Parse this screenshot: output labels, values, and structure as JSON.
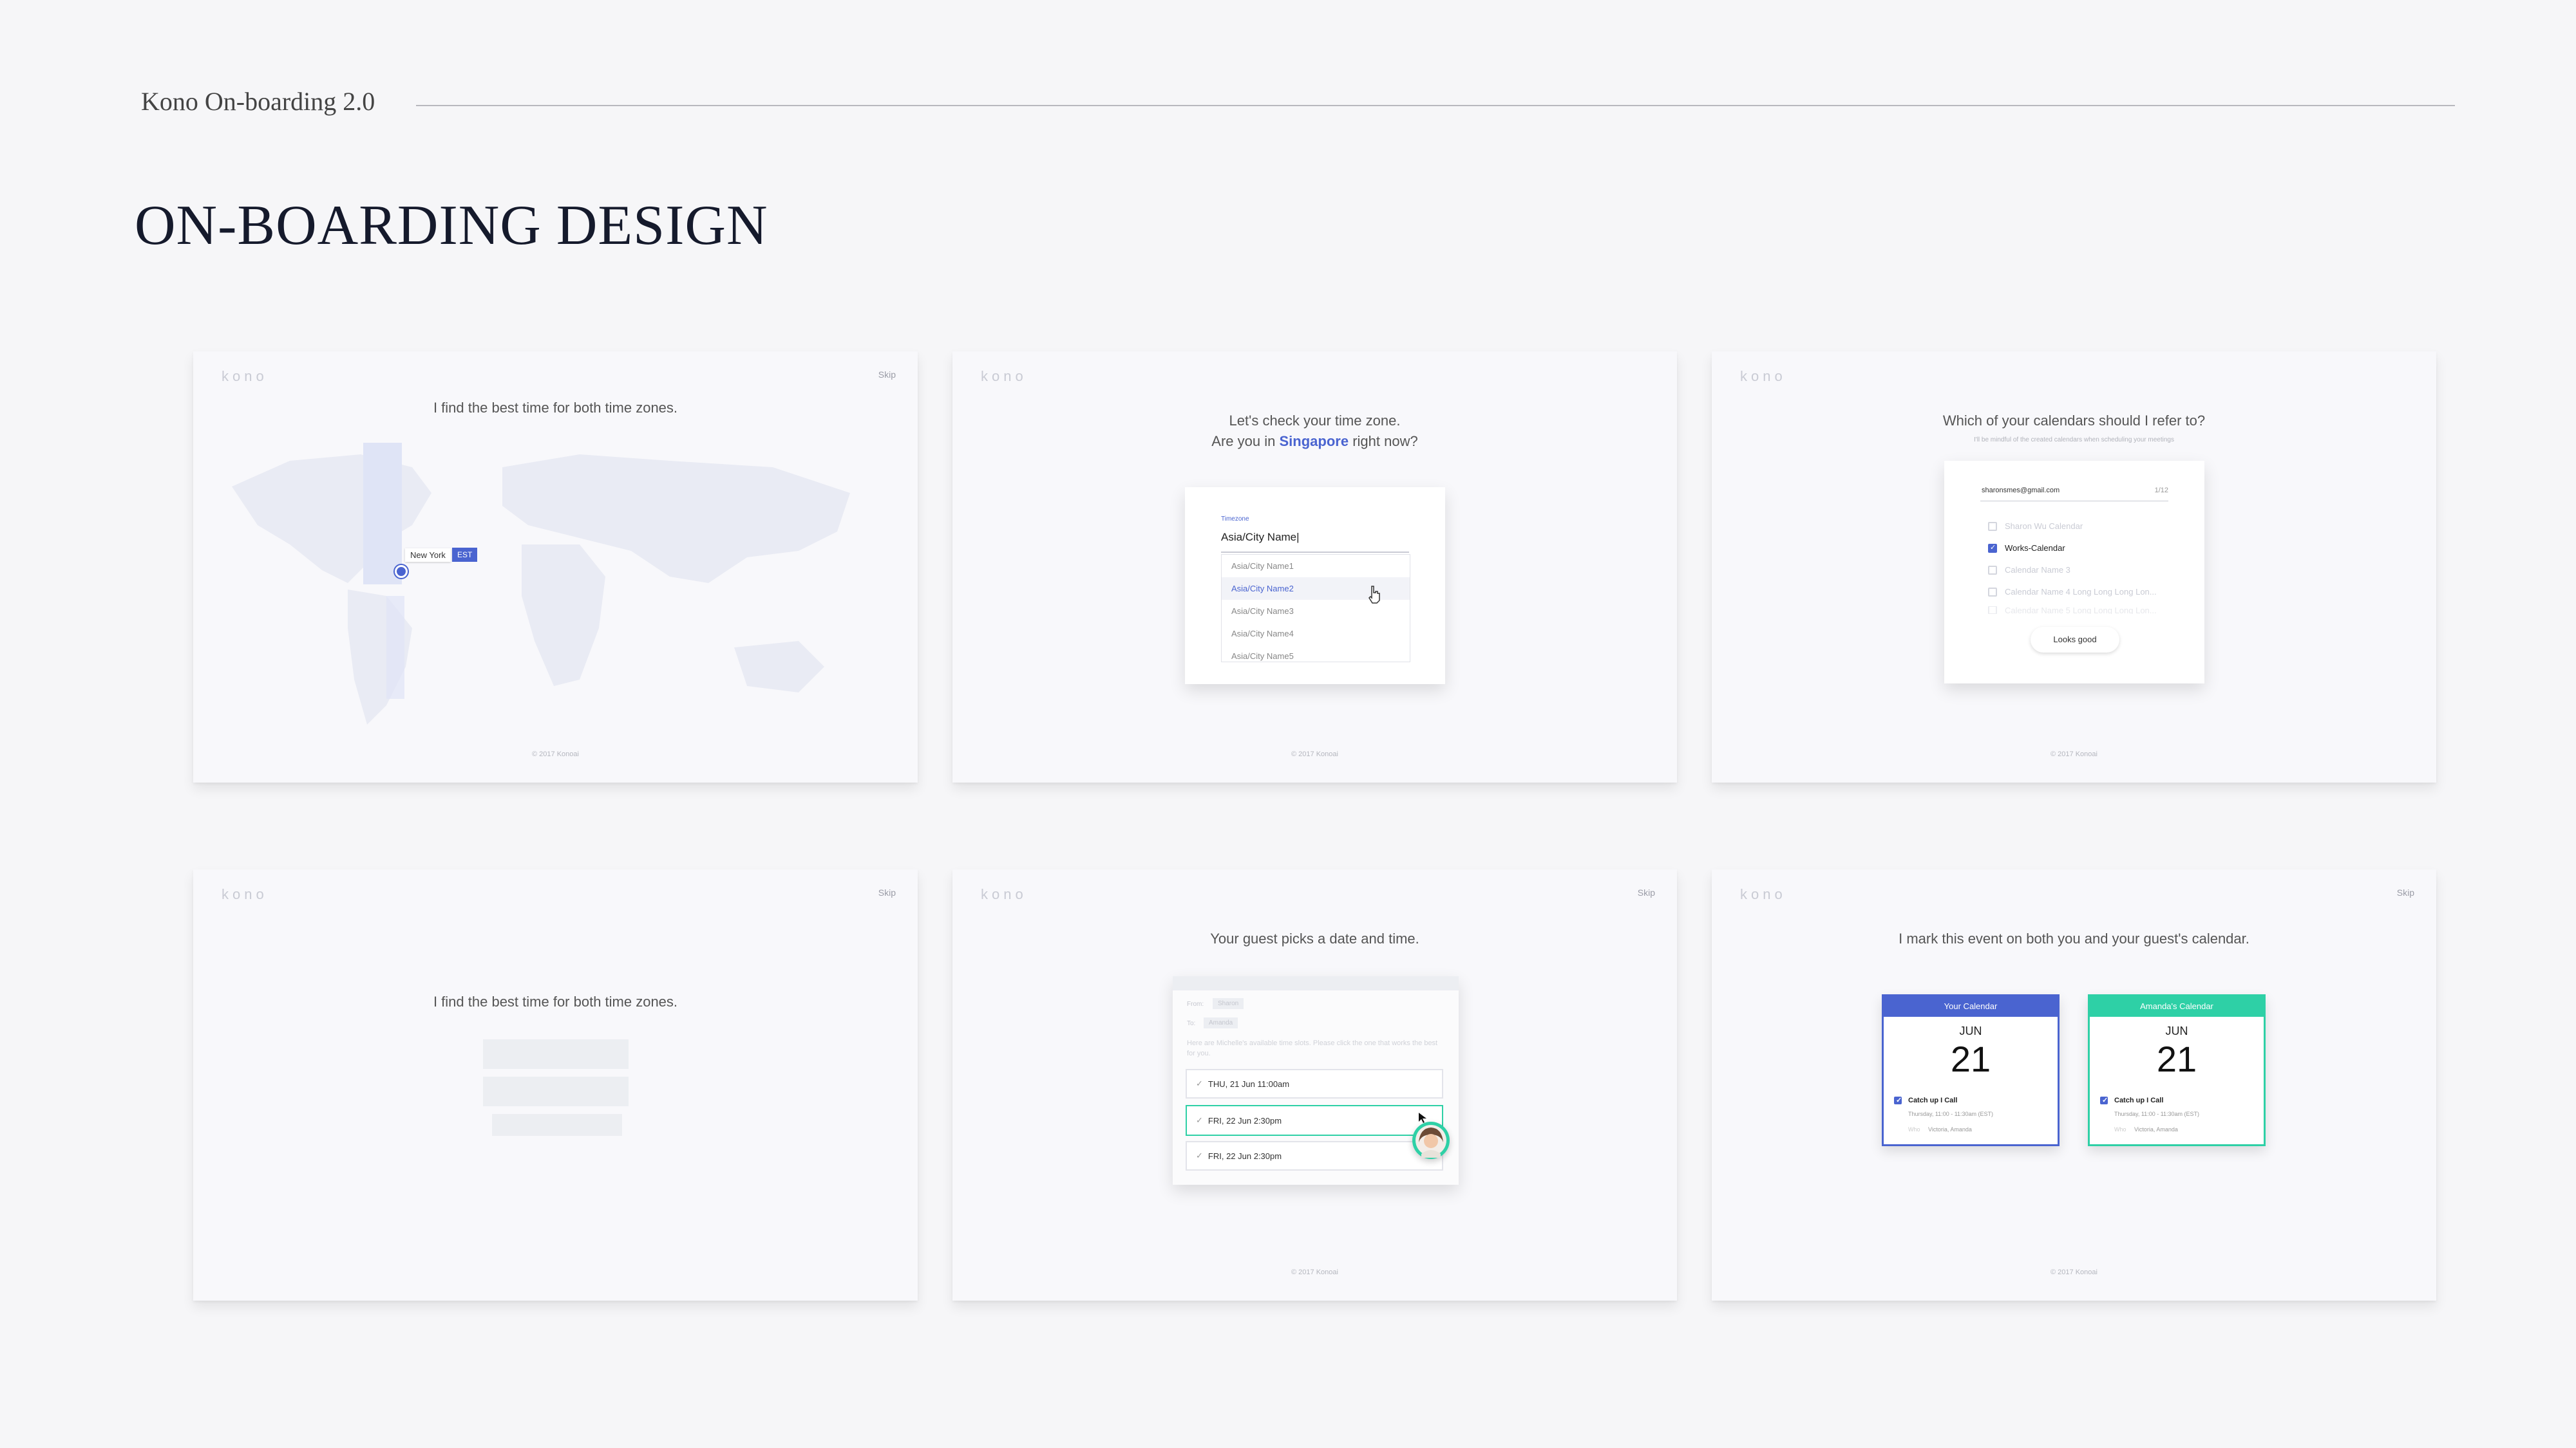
{
  "header": {
    "title": "Kono On-boarding 2.0",
    "page_title": "ON-BOARDING DESIGN"
  },
  "common": {
    "logo": "kono",
    "skip": "Skip",
    "footer": "© 2017 Konoai"
  },
  "card1": {
    "heading": "I find the best time for both time zones.",
    "city": "New York",
    "zone": "EST"
  },
  "card2": {
    "heading_line1": "Let's check your time zone.",
    "heading_prefix": "Are you in",
    "heading_city": "Singapore",
    "heading_suffix": "right now?",
    "field_label": "Timezone",
    "field_value": "Asia/City Name|",
    "options": [
      "Asia/City Name1",
      "Asia/City Name2",
      "Asia/City Name3",
      "Asia/City Name4",
      "Asia/City Name5"
    ]
  },
  "card3": {
    "heading": "Which of your calendars should I refer to?",
    "subheading": "I'll be mindful of the created calendars when scheduling your meetings",
    "email": "sharonsmes@gmail.com",
    "count": "1/12",
    "calendars": [
      {
        "label": "Sharon Wu Calendar",
        "checked": false
      },
      {
        "label": "Works-Calendar",
        "checked": true
      },
      {
        "label": "Calendar Name 3",
        "checked": false
      },
      {
        "label": "Calendar Name 4 Long Long Long Lon...",
        "checked": false
      },
      {
        "label": "Calendar Name 5 Long Long Long Lon...",
        "checked": false
      }
    ],
    "button": "Looks good"
  },
  "card4": {
    "heading": "I find the best time for both time zones."
  },
  "card5": {
    "heading": "Your guest picks a date and time.",
    "from_label": "From:",
    "from_value": "Sharon",
    "to_label": "To:",
    "to_value": "Amanda",
    "body": "Here are Michelle's available time slots. Please click the one that works the best for you.",
    "slots": [
      "THU, 21 Jun  11:00am",
      "FRI, 22 Jun  2:30pm",
      "FRI, 22 Jun  2:30pm"
    ]
  },
  "card6": {
    "heading": "I mark this event on both you and your guest's calendar.",
    "calendars": [
      {
        "title": "Your Calendar",
        "month": "JUN",
        "day": "21",
        "event": "Catch up  I  Call",
        "time": "Thursday, 11:00 - 11:30am (EST)",
        "who_label": "Who",
        "who": "Victoria, Amanda",
        "color": "#4a64d0"
      },
      {
        "title": "Amanda's Calendar",
        "month": "JUN",
        "day": "21",
        "event": "Catch up  I  Call",
        "time": "Thursday, 11:00 - 11:30am (EST)",
        "who_label": "Who",
        "who": "Victoria, Amanda",
        "color": "#2ed0a6"
      }
    ]
  },
  "colors": {
    "accent": "#4a64d0",
    "green": "#2ed0a6",
    "background": "#f6f6f8"
  }
}
